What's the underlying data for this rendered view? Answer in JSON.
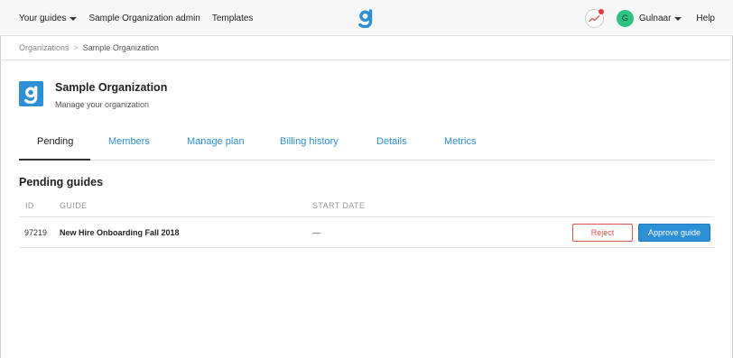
{
  "topnav": {
    "your_guides": "Your guides",
    "org_admin": "Sample Organization admin",
    "templates": "Templates",
    "logo_glyph": "g",
    "user_initial": "G",
    "user_name": "Gulnaar",
    "help": "Help"
  },
  "breadcrumb": {
    "items": [
      "Organizations",
      "Sample Organization"
    ],
    "separator": ">"
  },
  "org": {
    "logo_glyph": "g",
    "title": "Sample Organization",
    "subtitle": "Manage your organization"
  },
  "tabs": [
    {
      "label": "Pending",
      "active": true
    },
    {
      "label": "Members"
    },
    {
      "label": "Manage plan"
    },
    {
      "label": "Billing history"
    },
    {
      "label": "Details"
    },
    {
      "label": "Metrics"
    }
  ],
  "pending": {
    "title": "Pending guides",
    "columns": [
      "ID",
      "GUIDE",
      "START DATE"
    ],
    "rows": [
      {
        "id": "97219",
        "guide": "New Hire Onboarding Fall 2018",
        "start_date": "—",
        "reject": "Reject",
        "approve": "Approve guide"
      }
    ]
  },
  "colors": {
    "accent": "#2d8fd6",
    "danger": "#d9534f",
    "avatar": "#2ec27e",
    "notification": "#e53935"
  }
}
